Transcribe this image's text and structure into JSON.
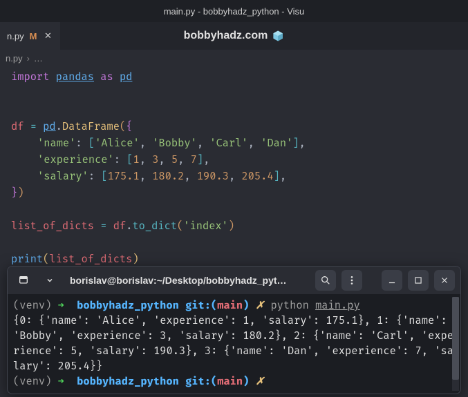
{
  "window": {
    "title": "main.py - bobbyhadz_python - Visu"
  },
  "tab": {
    "file": "n.py",
    "modified_badge": "M"
  },
  "banner": {
    "text": "bobbyhadz.com"
  },
  "breadcrumb": {
    "file": "n.py",
    "sep": "›",
    "more": "…"
  },
  "code": {
    "l1": {
      "import": "import",
      "module": "pandas",
      "as": "as",
      "alias": "pd"
    },
    "l3": {
      "var": "df",
      "eq": "=",
      "pd": "pd",
      "dot": ".",
      "cls": "DataFrame",
      "op": "(",
      "br": "{"
    },
    "l4": {
      "key": "'name'",
      "colon": ":",
      "ob": "[",
      "v1": "'Alice'",
      "v2": "'Bobby'",
      "v3": "'Carl'",
      "v4": "'Dan'",
      "cb": "]",
      "comma": ","
    },
    "l5": {
      "key": "'experience'",
      "colon": ":",
      "ob": "[",
      "v1": "1",
      "v2": "3",
      "v3": "5",
      "v4": "7",
      "cb": "]",
      "comma": ","
    },
    "l6": {
      "key": "'salary'",
      "colon": ":",
      "ob": "[",
      "v1": "175.1",
      "v2": "180.2",
      "v3": "190.3",
      "v4": "205.4",
      "cb": "]",
      "comma": ","
    },
    "l7": {
      "cb": "}",
      "cp": ")"
    },
    "l9": {
      "var": "list_of_dicts",
      "eq": "=",
      "df": "df",
      "dot": ".",
      "fn": "to_dict",
      "op": "(",
      "arg": "'index'",
      "cp": ")"
    },
    "l11": {
      "fn": "print",
      "op": "(",
      "arg": "list_of_dicts",
      "cp": ")"
    }
  },
  "terminal": {
    "title": "borislav@borislav:~/Desktop/bobbyhadz_pyt…",
    "prompt1": {
      "venv": "(venv)",
      "arrow": "➜",
      "dir": "bobbyhadz_python",
      "git": "git:(",
      "branch": "main",
      "gitc": ")",
      "x": "✗",
      "cmd": "python",
      "file": "main.py"
    },
    "output": "{0: {'name': 'Alice', 'experience': 1, 'salary': 175.1}, 1: {'name': 'Bobby', 'experience': 3, 'salary': 180.2}, 2: {'name': 'Carl', 'experience': 5, 'salary': 190.3}, 3: {'name': 'Dan', 'experience': 7, 'salary': 205.4}}",
    "prompt2": {
      "venv": "(venv)",
      "arrow": "➜",
      "dir": "bobbyhadz_python",
      "git": "git:(",
      "branch": "main",
      "gitc": ")",
      "x": "✗"
    }
  }
}
